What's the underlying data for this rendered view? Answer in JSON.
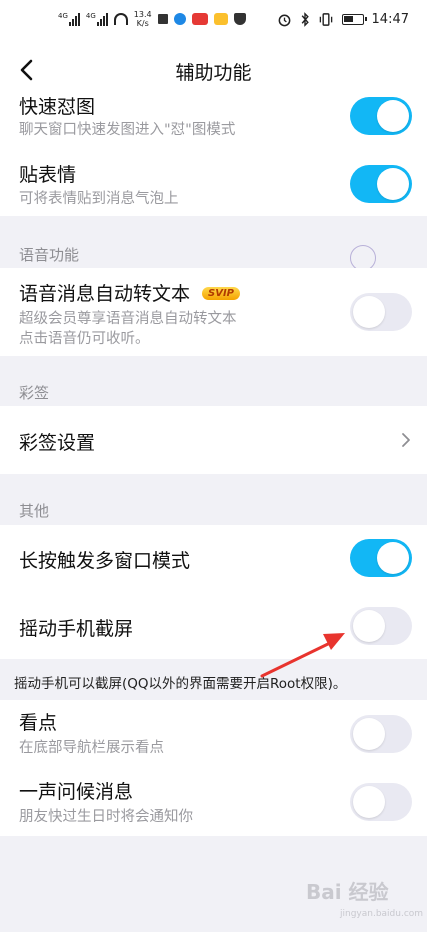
{
  "status_bar": {
    "network_tag_1": "4G",
    "network_tag_2": "4G",
    "speed_value": "13.4",
    "speed_unit": "K/s",
    "time": "14:47"
  },
  "header": {
    "title": "辅助功能"
  },
  "rows": {
    "quick_meme": {
      "title": "快速怼图",
      "subtitle": "聊天窗口快速发图进入\"怼\"图模式",
      "enabled": true
    },
    "sticker": {
      "title": "贴表情",
      "subtitle": "可将表情贴到消息气泡上",
      "enabled": true
    },
    "voice_to_text": {
      "title": "语音消息自动转文本",
      "badge": "SVIP",
      "subtitle_1": "超级会员尊享语音消息自动转文本",
      "subtitle_2": "点击语音仍可收听。",
      "enabled": false
    },
    "caiqian_settings": {
      "title": "彩签设置"
    },
    "long_press_multiwindow": {
      "title": "长按触发多窗口模式",
      "enabled": true
    },
    "shake_screenshot": {
      "title": "摇动手机截屏",
      "enabled": false
    },
    "kandian": {
      "title": "看点",
      "subtitle": "在底部导航栏展示看点",
      "enabled": false
    },
    "greeting": {
      "title": "一声问候消息",
      "subtitle": "朋友快过生日时将会通知你",
      "enabled": false
    }
  },
  "groups": {
    "voice": "语音功能",
    "caiqian": "彩签",
    "other": "其他"
  },
  "shake_note": "摇动手机可以截屏(QQ以外的界面需要开启Root权限)。",
  "watermark": {
    "brand": "Bai 经验",
    "url": "jingyan.baidu.com"
  },
  "colors": {
    "toggle_on": "#12b7f5",
    "toggle_off": "#e9e9f2",
    "annotation_arrow": "#e8342e"
  }
}
